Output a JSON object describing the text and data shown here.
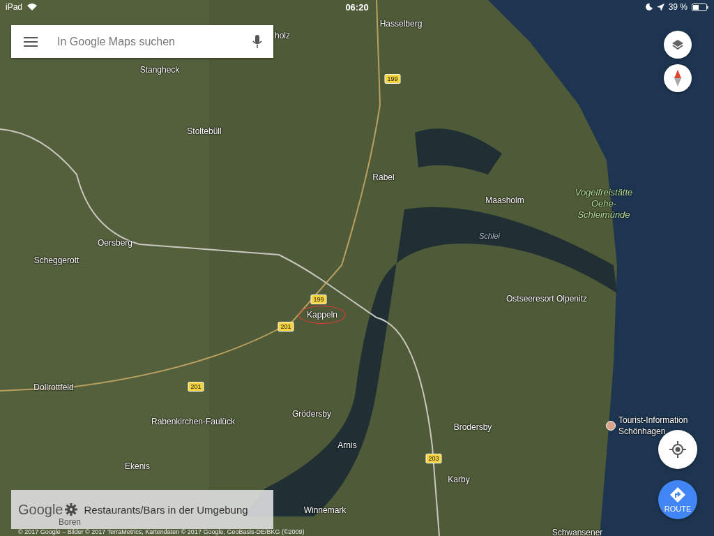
{
  "status_bar": {
    "device": "iPad",
    "time": "06:20",
    "battery": "39 %"
  },
  "search": {
    "placeholder": "In Google Maps suchen"
  },
  "map": {
    "places": [
      {
        "name": "Hasselberg",
        "kind": "town"
      },
      {
        "name": "holz",
        "kind": "town"
      },
      {
        "name": "Stangheck",
        "kind": "town"
      },
      {
        "name": "Stoltebüll",
        "kind": "town"
      },
      {
        "name": "Rabel",
        "kind": "town"
      },
      {
        "name": "Maasholm",
        "kind": "town"
      },
      {
        "name": "Vogelfreistätte Oehe-Schleimünde",
        "kind": "park"
      },
      {
        "name": "Schlei",
        "kind": "water"
      },
      {
        "name": "Oersberg",
        "kind": "town"
      },
      {
        "name": "Scheggerott",
        "kind": "town"
      },
      {
        "name": "Ostseeresort Olpenitz",
        "kind": "town"
      },
      {
        "name": "Kappeln",
        "kind": "searched"
      },
      {
        "name": "Dollrottfeld",
        "kind": "town"
      },
      {
        "name": "Grödersby",
        "kind": "town"
      },
      {
        "name": "Rabenkirchen-Faulück",
        "kind": "town"
      },
      {
        "name": "Brodersby",
        "kind": "town"
      },
      {
        "name": "Tourist-Information Schönhagen",
        "kind": "poi"
      },
      {
        "name": "Arnis",
        "kind": "town"
      },
      {
        "name": "Ekenis",
        "kind": "town"
      },
      {
        "name": "Karby",
        "kind": "town"
      },
      {
        "name": "Winnemark",
        "kind": "town"
      },
      {
        "name": "Boren",
        "kind": "covered"
      },
      {
        "name": "Schwansener",
        "kind": "town"
      }
    ],
    "road_shields": [
      "199",
      "199",
      "201",
      "201",
      "203"
    ]
  },
  "suggestion": {
    "logo": "Google",
    "text": "Restaurants/Bars in der Umgebung"
  },
  "route_button": {
    "label": "ROUTE"
  },
  "attribution": "© 2017 Google – Bilder © 2017 TerraMetrics, Kartendaten © 2017 Google, GeoBasis-DE/BKG (©2009)"
}
